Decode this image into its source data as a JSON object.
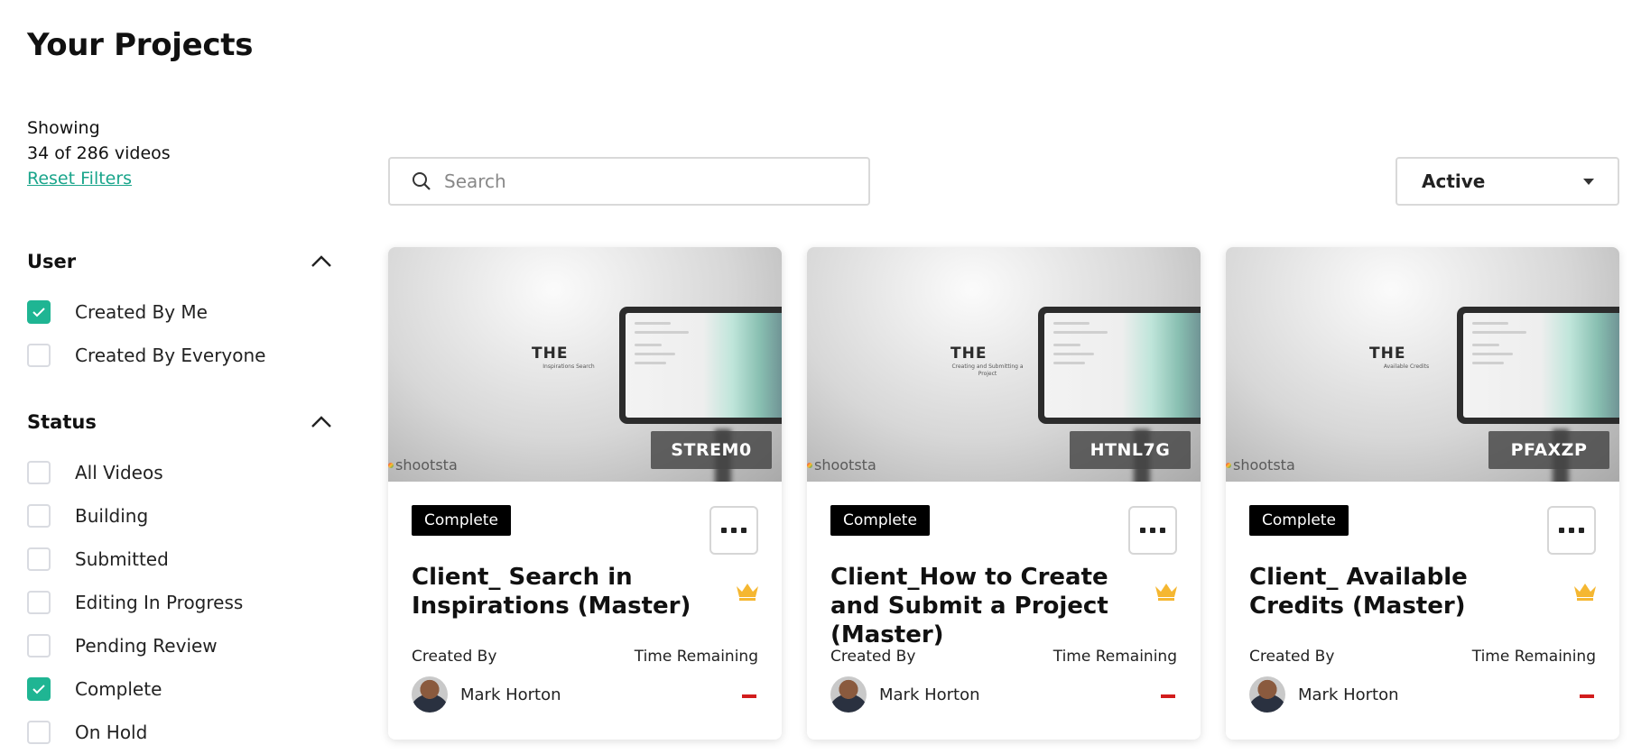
{
  "page": {
    "title": "Your Projects"
  },
  "summary": {
    "showing_label": "Showing",
    "count_text": "34 of 286 videos",
    "reset_label": "Reset Filters"
  },
  "filters": {
    "user": {
      "title": "User",
      "options": [
        {
          "label": "Created By Me",
          "checked": true
        },
        {
          "label": "Created By Everyone",
          "checked": false
        }
      ]
    },
    "status": {
      "title": "Status",
      "options": [
        {
          "label": "All Videos",
          "checked": false
        },
        {
          "label": "Building",
          "checked": false
        },
        {
          "label": "Submitted",
          "checked": false
        },
        {
          "label": "Editing In Progress",
          "checked": false
        },
        {
          "label": "Pending Review",
          "checked": false
        },
        {
          "label": "Complete",
          "checked": true
        },
        {
          "label": "On Hold",
          "checked": false
        }
      ]
    }
  },
  "search": {
    "placeholder": "Search"
  },
  "state_select": {
    "value": "Active"
  },
  "cards": [
    {
      "code": "STREM0",
      "status": "Complete",
      "title": "Client_ Search in Inspirations (Master)",
      "thumb_heading": "THE",
      "thumb_subtitle": "Inspirations Search",
      "brand": "shootsta",
      "created_by_label": "Created By",
      "time_label": "Time Remaining",
      "user": "Mark Horton"
    },
    {
      "code": "HTNL7G",
      "status": "Complete",
      "title": "Client_How to Create and Submit a Project (Master)",
      "thumb_heading": "THE",
      "thumb_subtitle": "Creating and Submitting a Project",
      "brand": "shootsta",
      "created_by_label": "Created By",
      "time_label": "Time Remaining",
      "user": "Mark Horton"
    },
    {
      "code": "PFAXZP",
      "status": "Complete",
      "title": "Client_ Available Credits (Master)",
      "thumb_heading": "THE",
      "thumb_subtitle": "Available Credits",
      "brand": "shootsta",
      "created_by_label": "Created By",
      "time_label": "Time Remaining",
      "user": "Mark Horton"
    }
  ],
  "colors": {
    "accent": "#1fb593",
    "link": "#1aa58b",
    "badge_bg": "#000000",
    "crown": "#f5b731",
    "time_indicator": "#d21c1c"
  },
  "icons": {
    "search": "search-icon",
    "collapse": "chevron-up-icon",
    "dropdown": "caret-down-icon",
    "more": "more-options-icon",
    "premium": "crown-icon",
    "check": "check-icon"
  }
}
